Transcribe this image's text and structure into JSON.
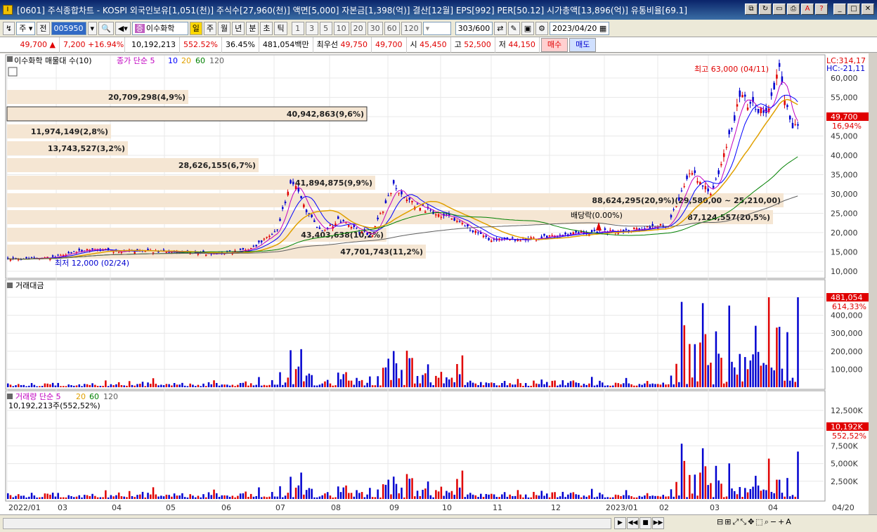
{
  "window": {
    "title": "[0601] 주식종합차트 - KOSPI 외국인보유[1,051(천)] 주식수[27,960(천)] 액면[5,000] 자본금[1,398(억)] 결산[12월] EPS[992] PER[50.12] 시가총액[13,896(억)] 유통비율[69.1]"
  },
  "toolbar": {
    "period_label": "주",
    "prev_label": "전",
    "stock_code": "005950",
    "stock_name": "이수화학",
    "intervals": [
      "일",
      "주",
      "월",
      "년",
      "분",
      "초",
      "틱"
    ],
    "numbers": [
      "1",
      "3",
      "5",
      "10",
      "20",
      "30",
      "60",
      "120"
    ],
    "count": "303",
    "count_total": "/600",
    "date": "2023/04/20"
  },
  "quote": {
    "price": "49,700",
    "price_arrow": "▲",
    "change": "7,200",
    "change_pct": "+16.94%",
    "volume": "10,192,213",
    "volume_ratio": "552.52%",
    "turnover": "36.45%",
    "amount": "481,054백만",
    "best_bid_label": "최우선",
    "best_ask": "49,750",
    "best_bid": "49,700",
    "open_label": "시",
    "open": "45,450",
    "high_label": "고",
    "high": "52,500",
    "low_label": "저",
    "low": "44,150",
    "buy_label": "매수",
    "sell_label": "매도"
  },
  "price_panel": {
    "title": "이수화학 매물대 수(10)",
    "ma_label": "종가 단순 5",
    "ma_periods": [
      "10",
      "20",
      "60",
      "120"
    ],
    "high_annotation": "최고 63,000 (04/11)",
    "low_annotation": "최저 12,000 (02/24)",
    "dividend_annotation": "배당락(0.00%)",
    "lc_label": "LC:314,17",
    "hc_label": "HC:-21,11",
    "price_tag": "49,700",
    "pct_tag": "16,94%",
    "y_ticks": [
      "60,000",
      "55,000",
      "50,000",
      "45,000",
      "40,000",
      "35,000",
      "30,000",
      "25,000",
      "20,000",
      "15,000",
      "10,000"
    ],
    "volume_profile": [
      "20,709,298(4,9%)",
      "40,942,863(9,6%)",
      "11,974,149(2,8%)",
      "13,743,527(3,2%)",
      "28,626,155(6,7%)",
      "41,894,875(9,9%)",
      "88,624,295(20,9%)(29,580,00 ~ 25,210,00)",
      "87,124,557(20,5%)",
      "43,403,638(10,2%)",
      "47,701,743(11,2%)"
    ]
  },
  "amount_panel": {
    "title": "거래대금",
    "tag_value": "481,054",
    "tag_pct": "614,33%",
    "y_ticks": [
      "500,000",
      "400,000",
      "300,000",
      "200,000",
      "100,000"
    ]
  },
  "volume_panel": {
    "title": "거래량 단순 5",
    "ma_periods": [
      "20",
      "60",
      "120"
    ],
    "subtitle": "10,192,213주(552,52%)",
    "tag_value": "10,192K",
    "tag_pct": "552,52%",
    "y_ticks": [
      "12,500K",
      "10,000K",
      "7,500K",
      "5,000K",
      "2,500K"
    ]
  },
  "x_axis": {
    "labels": [
      "2022/01",
      "03",
      "04",
      "05",
      "06",
      "07",
      "08",
      "09",
      "10",
      "11",
      "12",
      "2023/01",
      "02",
      "03",
      "04"
    ],
    "right_label": "04/20"
  },
  "colors": {
    "up": "#e00000",
    "down": "#0000d0",
    "ma5": "#c000c0",
    "ma10": "#0000ff",
    "ma20": "#e0a000",
    "ma60": "#008000",
    "ma120": "#606060",
    "profile": "#f5e6d3"
  }
}
